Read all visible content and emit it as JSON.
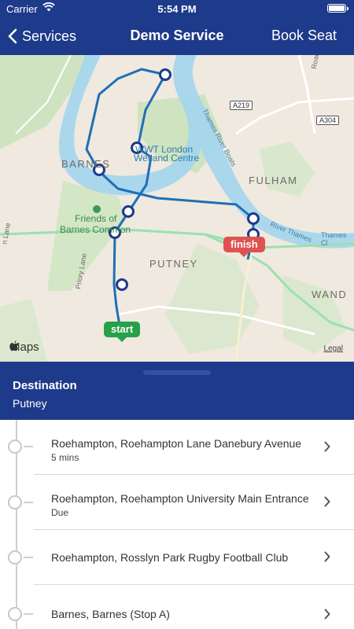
{
  "status_bar": {
    "carrier": "Carrier",
    "time": "5:54 PM"
  },
  "nav": {
    "back_label": "Services",
    "title": "Demo Service",
    "action_label": "Book Seat"
  },
  "map": {
    "labels": [
      "BARNES",
      "FULHAM",
      "PUTNEY",
      "WAND",
      "Friends of",
      "Barnes Common",
      "WWT London",
      "Wetland Centre",
      "Thames River Boats",
      "River Thames",
      "Thames Cl",
      "Priory Lane",
      "n Lane",
      "Road"
    ],
    "roads": [
      "A219",
      "A304"
    ],
    "pins": {
      "start": "start",
      "finish": "finish"
    },
    "attribution": "Maps",
    "legal": "Legal"
  },
  "destination": {
    "heading": "Destination",
    "value": "Putney"
  },
  "stops": [
    {
      "name": "Roehampton, Roehampton Lane  Danebury Avenue",
      "eta": "5 mins"
    },
    {
      "name": "Roehampton, Roehampton University Main Entrance",
      "eta": "Due"
    },
    {
      "name": "Roehampton, Rosslyn Park Rugby Football Club",
      "eta": ""
    },
    {
      "name": "Barnes, Barnes (Stop A)",
      "eta": ""
    }
  ],
  "colors": {
    "brand": "#1e3a8a",
    "route": "#1f6fb5",
    "start": "#27a04a",
    "finish": "#e05252"
  }
}
